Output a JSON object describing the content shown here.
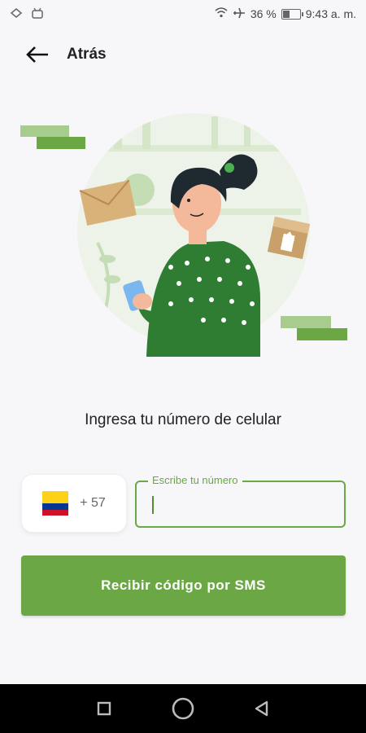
{
  "status_bar": {
    "battery_percent": "36 %",
    "battery_level": 0.36,
    "time": "9:43 a. m.",
    "icons": [
      "notification-icon",
      "android-icon",
      "wifi-icon",
      "airplane-icon",
      "battery-icon"
    ]
  },
  "header": {
    "back_label": "Atrás",
    "back_icon": "arrow-left-icon"
  },
  "main": {
    "heading": "Ingresa tu número de celular",
    "country": {
      "flag": "colombia-flag",
      "dial_code": "+ 57"
    },
    "phone_field": {
      "label": "Escribe tu número",
      "value": ""
    },
    "submit_label": "Recibir código por SMS"
  },
  "colors": {
    "accent": "#6ba845",
    "background": "#f7f7f9",
    "text": "#222222"
  },
  "nav_bar": {
    "icons": [
      "recents-icon",
      "home-icon",
      "back-triangle-icon"
    ]
  }
}
